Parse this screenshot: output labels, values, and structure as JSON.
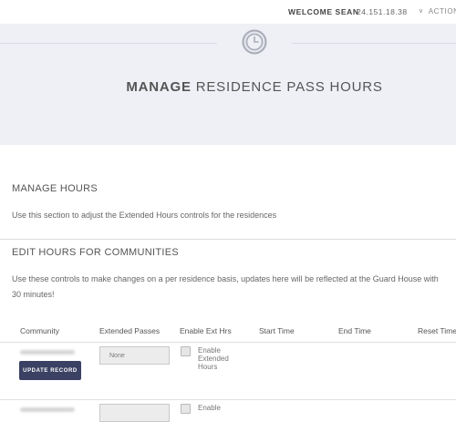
{
  "header": {
    "welcome": "WELCOME SEAN",
    "ip": "24.151.18.38",
    "actions_label": "ACTION"
  },
  "hero": {
    "title_bold": "MANAGE",
    "title_rest": "RESIDENCE PASS HOURS"
  },
  "manage_hours": {
    "heading": "MANAGE HOURS",
    "description": "Use this section to adjust the Extended Hours controls for the residences"
  },
  "edit_hours": {
    "heading": "EDIT HOURS FOR COMMUNITIES",
    "description_line1": "Use these controls to make changes on a per residence basis, updates here will be reflected at the Guard House with",
    "description_line2": "30 minutes!"
  },
  "table": {
    "columns": [
      "Community",
      "Extended Passes",
      "Enable Ext Hrs",
      "Start Time",
      "End Time",
      "Reset Time"
    ],
    "rows": [
      {
        "update_label": "UPDATE RECORD",
        "extended_passes_value": "None",
        "enable_label": [
          "Enable",
          "Extended",
          "Hours"
        ],
        "enabled": false
      },
      {
        "enable_label": [
          "Enable"
        ],
        "enabled": false
      }
    ]
  },
  "colors": {
    "hero_bg": "#eef0f6",
    "button_bg": "#3b4163",
    "text": "#555555"
  }
}
